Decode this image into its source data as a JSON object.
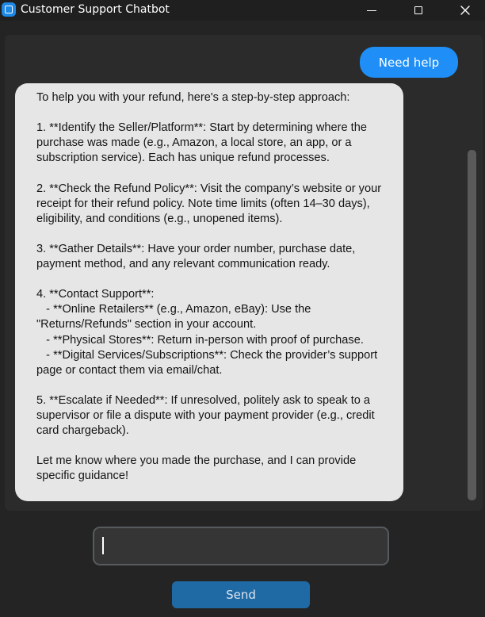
{
  "window": {
    "title": "Customer Support Chatbot",
    "controls": {
      "minimize": "minimize-icon",
      "maximize": "maximize-icon",
      "close": "close-icon"
    }
  },
  "chat": {
    "messages": [
      {
        "role": "user",
        "text": "Need help"
      },
      {
        "role": "bot",
        "text": "To help you with your refund, here's a step-by-step approach:\n\n1. **Identify the Seller/Platform**: Start by determining where the purchase was made (e.g., Amazon, a local store, an app, or a subscription service). Each has unique refund processes.\n\n2. **Check the Refund Policy**: Visit the company’s website or your receipt for their refund policy. Note time limits (often 14–30 days), eligibility, and conditions (e.g., unopened items).\n\n3. **Gather Details**: Have your order number, purchase date, payment method, and any relevant communication ready.\n\n4. **Contact Support**:\n   - **Online Retailers** (e.g., Amazon, eBay): Use the \"Returns/Refunds\" section in your account.\n   - **Physical Stores**: Return in-person with proof of purchase.\n   - **Digital Services/Subscriptions**: Check the provider’s support page or contact them via email/chat.\n\n5. **Escalate if Needed**: If unresolved, politely ask to speak to a supervisor or file a dispute with your payment provider (e.g., credit card chargeback).\n\nLet me know where you made the purchase, and I can provide specific guidance!"
      }
    ]
  },
  "input": {
    "value": "",
    "placeholder": ""
  },
  "send_button": {
    "label": "Send"
  },
  "colors": {
    "background": "#242424",
    "chat_frame": "#2b2b2b",
    "user_bubble": "#1f8ff7",
    "bot_bubble": "#e6e6e6",
    "send_button": "#1f6aa5"
  }
}
